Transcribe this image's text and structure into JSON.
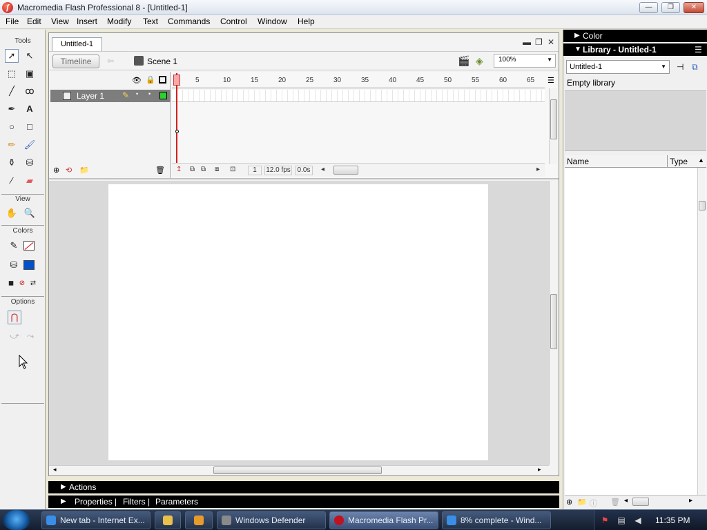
{
  "window": {
    "title": "Macromedia Flash Professional 8 - [Untitled-1]",
    "controls": {
      "minimize": "—",
      "maximize": "❐",
      "close": "✕"
    }
  },
  "menu": [
    "File",
    "Edit",
    "View",
    "Insert",
    "Modify",
    "Text",
    "Commands",
    "Control",
    "Window",
    "Help"
  ],
  "tools": {
    "heading": "Tools",
    "view_heading": "View",
    "colors_heading": "Colors",
    "options_heading": "Options",
    "stroke_color": "#000000",
    "fill_color": "#0052cc"
  },
  "document": {
    "tab": "Untitled-1",
    "timeline_button": "Timeline",
    "scene": "Scene 1",
    "zoom": "100%"
  },
  "timeline": {
    "layer_name": "Layer 1",
    "ruler": [
      "5",
      "10",
      "15",
      "20",
      "25",
      "30",
      "35",
      "40",
      "45",
      "50",
      "55",
      "60",
      "65"
    ],
    "current_frame": "1",
    "frame_rate": "12.0 fps",
    "elapsed": "0.0s"
  },
  "panels": {
    "actions": "Actions",
    "properties": "Properties",
    "filters": "Filters",
    "parameters": "Parameters",
    "sep": "|"
  },
  "right": {
    "color_panel": "Color",
    "library_panel": "Library - Untitled-1",
    "library_select": "Untitled-1",
    "empty_text": "Empty library",
    "col_name": "Name",
    "col_type": "Type"
  },
  "taskbar": {
    "items": [
      {
        "label": "New tab - Internet Ex...",
        "color": "#3a8ee6"
      },
      {
        "label": "",
        "color": "#e8c04a"
      },
      {
        "label": "",
        "color": "#e89a2a"
      },
      {
        "label": "Windows Defender",
        "color": "#8a8a8a"
      },
      {
        "label": "Macromedia Flash Pr...",
        "color": "#c1121f"
      },
      {
        "label": "8% complete - Wind...",
        "color": "#3a8ee6"
      }
    ],
    "clock": "11:35 PM"
  }
}
